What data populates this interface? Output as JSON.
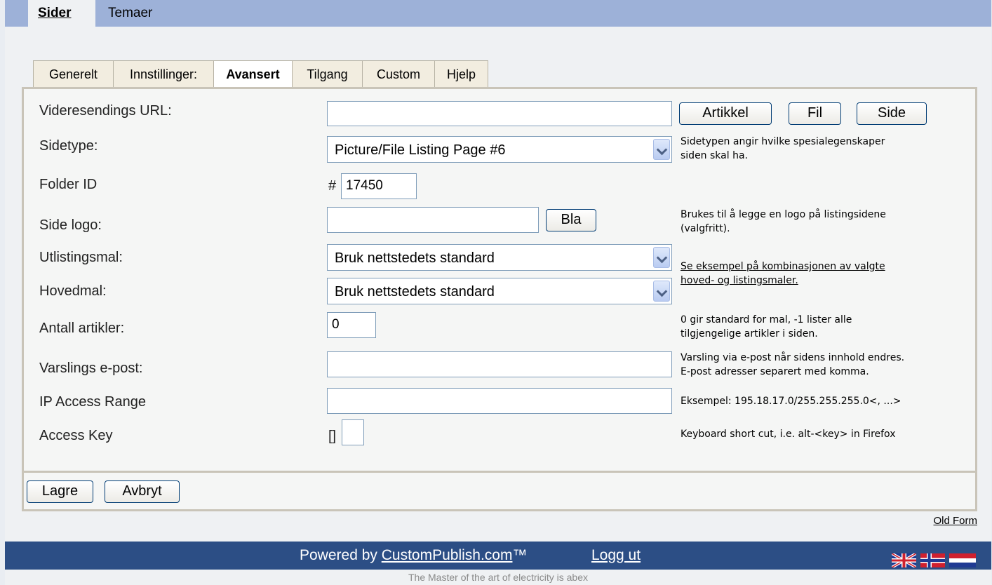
{
  "top_nav": {
    "items": [
      "Sider",
      "Temaer"
    ]
  },
  "tabs": [
    "Generelt",
    "Innstillinger:",
    "Avansert",
    "Tilgang",
    "Custom",
    "Hjelp"
  ],
  "form": {
    "redirect_url": {
      "label": "Videresendings URL:",
      "value": ""
    },
    "link_buttons": [
      "Artikkel",
      "Fil",
      "Side"
    ],
    "page_type": {
      "label": "Sidetype:",
      "selected": "Picture/File Listing Page #6",
      "help_line1": "Sidetypen angir hvilke spesialegenskaper",
      "help_line2": "siden skal ha."
    },
    "folder_id": {
      "label": "Folder ID",
      "prefix": "#",
      "value": "17450"
    },
    "page_logo": {
      "label": "Side logo:",
      "value": "",
      "browse_button": "Bla",
      "help_line1": "Brukes til å legge en logo på listingsidene",
      "help_line2": "(valgfritt)."
    },
    "listing_template": {
      "label": "Utlistingsmal:",
      "selected": "Bruk nettstedets standard"
    },
    "main_template": {
      "label": "Hovedmal:",
      "selected": "Bruk nettstedets standard"
    },
    "template_link_line1": "Se eksempel på kombinasjonen av valgte",
    "template_link_line2": "hoved- og listingsmaler.",
    "article_count": {
      "label": "Antall artikler:",
      "value": "0",
      "help_line1": "0 gir standard for mal, -1 lister alle",
      "help_line2": "tilgjengelige artikler i siden."
    },
    "notify_email": {
      "label": "Varslings e-post:",
      "value": "",
      "help_line1": "Varsling via e-post når sidens innhold endres.",
      "help_line2": "E-post adresser separert med komma."
    },
    "ip_range": {
      "label": "IP Access Range",
      "value": "",
      "help": "Eksempel: 195.18.17.0/255.255.255.0<, ...>"
    },
    "access_key": {
      "label": "Access Key",
      "prefix": "[]",
      "value": "",
      "help": "Keyboard short cut, i.e. alt-<key> in Firefox"
    }
  },
  "actions": {
    "save": "Lagre",
    "cancel": "Avbryt"
  },
  "old_form_link": "Old Form",
  "footer": {
    "powered_by": "Powered by ",
    "brand_link": "CustomPublish.com",
    "trademark": "™",
    "logout": "Logg ut",
    "tagline": "The Master of the art of electricity is abex"
  },
  "colors": {
    "top_bar": "#9db1d8",
    "footer": "#2c4e85",
    "panel_border": "#c9c4b8"
  },
  "language_flags": [
    "uk-flag-icon",
    "norway-flag-icon",
    "netherlands-flag-icon"
  ]
}
